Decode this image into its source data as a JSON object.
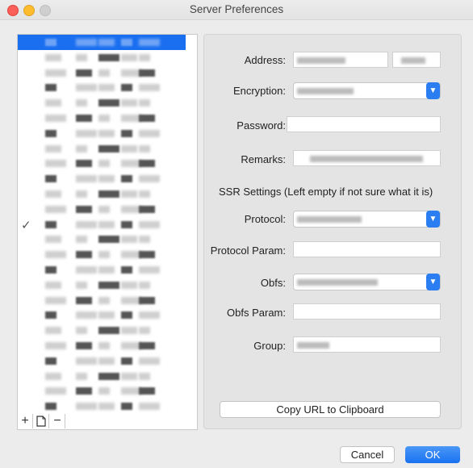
{
  "window": {
    "title": "Server Preferences"
  },
  "form": {
    "address_label": "Address:",
    "encryption_label": "Encryption:",
    "password_label": "Password:",
    "remarks_label": "Remarks:",
    "ssr_settings_label": "SSR Settings (Left empty if not sure what it is)",
    "protocol_label": "Protocol:",
    "protocol_param_label": "Protocol Param:",
    "obfs_label": "Obfs:",
    "obfs_param_label": "Obfs Param:",
    "group_label": "Group:"
  },
  "buttons": {
    "copy_url": "Copy URL to Clipboard",
    "cancel": "Cancel",
    "ok": "OK",
    "add": "+",
    "remove": "−"
  },
  "list": {
    "selected_check": "✓"
  },
  "colors": {
    "accent": "#1a72f0",
    "selection": "#1a6ff0",
    "close": "#fc5f57",
    "minimize": "#fdbc2e"
  }
}
